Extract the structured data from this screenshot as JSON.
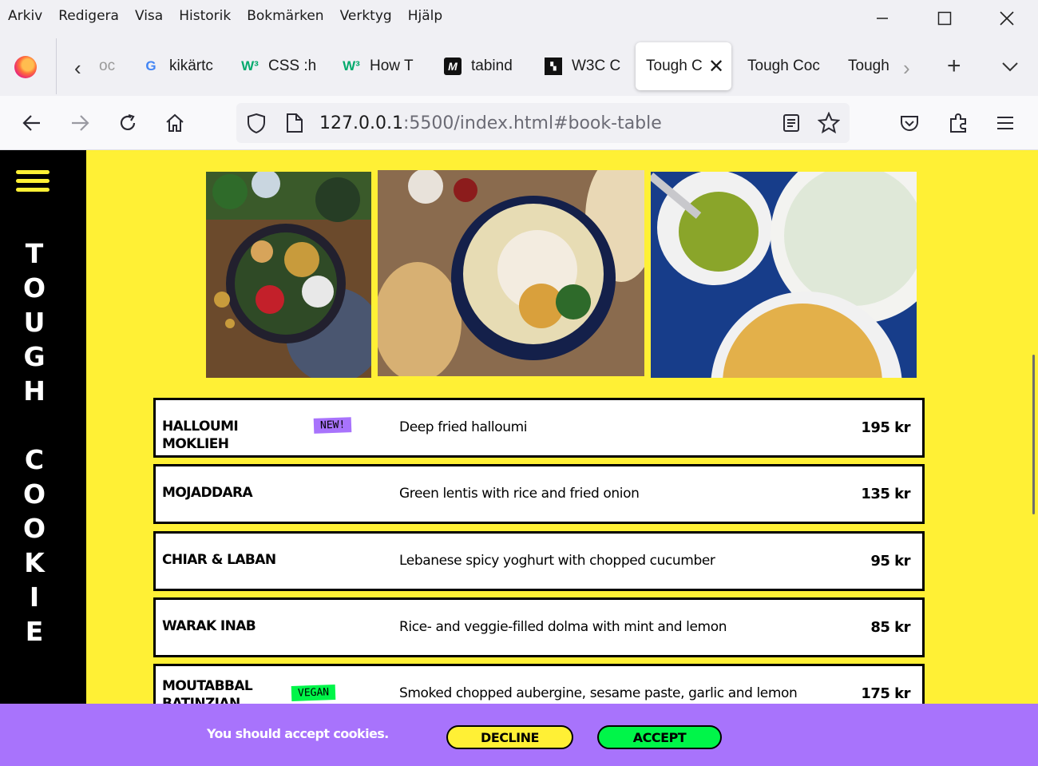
{
  "menubar": [
    "Arkiv",
    "Redigera",
    "Visa",
    "Historik",
    "Bokmärken",
    "Verktyg",
    "Hjälp"
  ],
  "window_controls": {
    "minimize": "—",
    "maximize": "☐",
    "close": "✕"
  },
  "tabs": [
    {
      "label": "oc",
      "favicon": "generic"
    },
    {
      "label": "kikärtc",
      "favicon": "G"
    },
    {
      "label": "CSS :h",
      "favicon": "W3"
    },
    {
      "label": "How T",
      "favicon": "W3"
    },
    {
      "label": "tabind",
      "favicon": "M"
    },
    {
      "label": "W3C C",
      "favicon": "W3C"
    },
    {
      "label": "Tough C",
      "favicon": "",
      "active": true
    },
    {
      "label": "Tough Coc",
      "favicon": ""
    },
    {
      "label": "Tough",
      "favicon": ""
    }
  ],
  "url": {
    "host": "127.0.0.1",
    "rest": ":5500/index.html#book-table"
  },
  "site": {
    "logo_text": "TOUGH COOKIE"
  },
  "menu_items": [
    {
      "name": "HALLOUMI MOKLIEH",
      "tag": "NEW!",
      "description": "Deep fried halloumi",
      "price": "195 kr"
    },
    {
      "name": "MOJADDARA",
      "tag": "",
      "description": "Green lentis with rice and fried onion",
      "price": "135 kr"
    },
    {
      "name": "CHIAR & LABAN",
      "tag": "",
      "description": "Lebanese spicy yoghurt with chopped cucumber",
      "price": "95 kr"
    },
    {
      "name": "WARAK INAB",
      "tag": "",
      "description": "Rice- and veggie-filled dolma with mint and lemon",
      "price": "85 kr"
    },
    {
      "name": "MOUTABBAL BATINZIAN",
      "tag": "VEGAN",
      "description": "Smoked chopped aubergine, sesame paste, garlic and lemon",
      "price": "175 kr"
    }
  ],
  "cookie": {
    "message": "You should accept cookies.",
    "decline": "DECLINE",
    "accept": "ACCEPT"
  },
  "colors": {
    "page_bg": "#fff035",
    "sidebar": "#000000",
    "cookie_bar": "#a873fc",
    "decline": "#fff035",
    "accept": "#00f549",
    "tag_new": "#a873fc",
    "tag_vegan": "#00f549"
  }
}
